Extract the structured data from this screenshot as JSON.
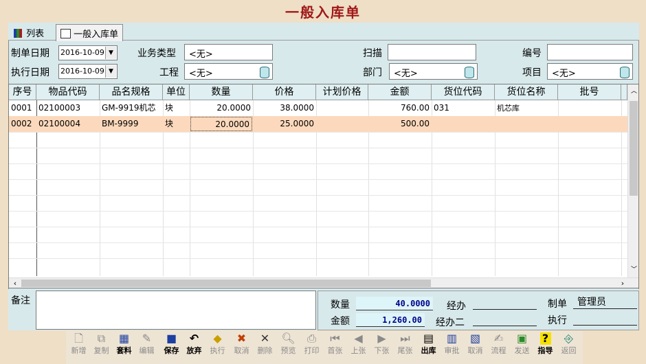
{
  "window": {
    "title": "一般入库单"
  },
  "tabs": [
    {
      "label": "列表"
    },
    {
      "label": "一般入库单"
    }
  ],
  "form": {
    "create_date_label": "制单日期",
    "create_date": "2016-10-09",
    "exec_date_label": "执行日期",
    "exec_date": "2016-10-09",
    "biz_type_label": "业务类型",
    "biz_type": "<无>",
    "project_label": "工程",
    "project": "<无>",
    "scan_label": "扫描",
    "scan": "",
    "dept_label": "部门",
    "dept": "<无>",
    "number_label": "编号",
    "number": "",
    "item_label": "项目",
    "item": "<无>"
  },
  "table": {
    "headers": [
      "序号",
      "物品代码",
      "品名规格",
      "单位",
      "数量",
      "价格",
      "计划价格",
      "金额",
      "货位代码",
      "货位名称",
      "批号"
    ],
    "rows": [
      {
        "seq": "0001",
        "code": "02100003",
        "spec": "GM-9919机芯",
        "unit": "块",
        "qty": "20.0000",
        "price": "38.0000",
        "plan": "",
        "amount": "760.00",
        "loc_code": "031",
        "loc_name": "机芯库",
        "batch": ""
      },
      {
        "seq": "0002",
        "code": "02100004",
        "spec": "BM-9999",
        "unit": "块",
        "qty": "20.0000",
        "price": "25.0000",
        "plan": "",
        "amount": "500.00",
        "loc_code": "",
        "loc_name": "",
        "batch": ""
      }
    ]
  },
  "footer": {
    "remark_label": "备注",
    "remark": "",
    "qty_label": "数量",
    "qty_total": "40.0000",
    "amount_label": "金额",
    "amount_total": "1,260.00",
    "handler_label": "经办",
    "handler": "",
    "handler2_label": "经办二",
    "handler2": "",
    "maker_label": "制单",
    "maker": "管理员",
    "executor_label": "执行",
    "executor": ""
  },
  "toolbar": [
    {
      "label": "新增",
      "icon": "new-doc-icon",
      "enabled": false
    },
    {
      "label": "复制",
      "icon": "copy-icon",
      "enabled": false
    },
    {
      "label": "套料",
      "icon": "calc-icon",
      "enabled": true
    },
    {
      "label": "编辑",
      "icon": "edit-icon",
      "enabled": false
    },
    {
      "label": "保存",
      "icon": "save-icon",
      "enabled": true
    },
    {
      "label": "放弃",
      "icon": "undo-icon",
      "enabled": true
    },
    {
      "label": "执行",
      "icon": "execute-icon",
      "enabled": false
    },
    {
      "label": "取消",
      "icon": "cancel-icon",
      "enabled": false
    },
    {
      "label": "删除",
      "icon": "delete-icon",
      "enabled": false
    },
    {
      "label": "预览",
      "icon": "preview-icon",
      "enabled": false
    },
    {
      "label": "打印",
      "icon": "print-icon",
      "enabled": false
    },
    {
      "label": "首张",
      "icon": "first-icon",
      "enabled": false
    },
    {
      "label": "上张",
      "icon": "prev-icon",
      "enabled": false
    },
    {
      "label": "下张",
      "icon": "next-icon",
      "enabled": false
    },
    {
      "label": "尾张",
      "icon": "last-icon",
      "enabled": false
    },
    {
      "label": "出库",
      "icon": "outbound-icon",
      "enabled": true
    },
    {
      "label": "审批",
      "icon": "approve-icon",
      "enabled": false
    },
    {
      "label": "取消",
      "icon": "unapprove-icon",
      "enabled": false
    },
    {
      "label": "流程",
      "icon": "flow-icon",
      "enabled": false
    },
    {
      "label": "发送",
      "icon": "send-icon",
      "enabled": false
    },
    {
      "label": "指导",
      "icon": "help-icon",
      "enabled": true
    },
    {
      "label": "返回",
      "icon": "exit-icon",
      "enabled": false
    }
  ]
}
